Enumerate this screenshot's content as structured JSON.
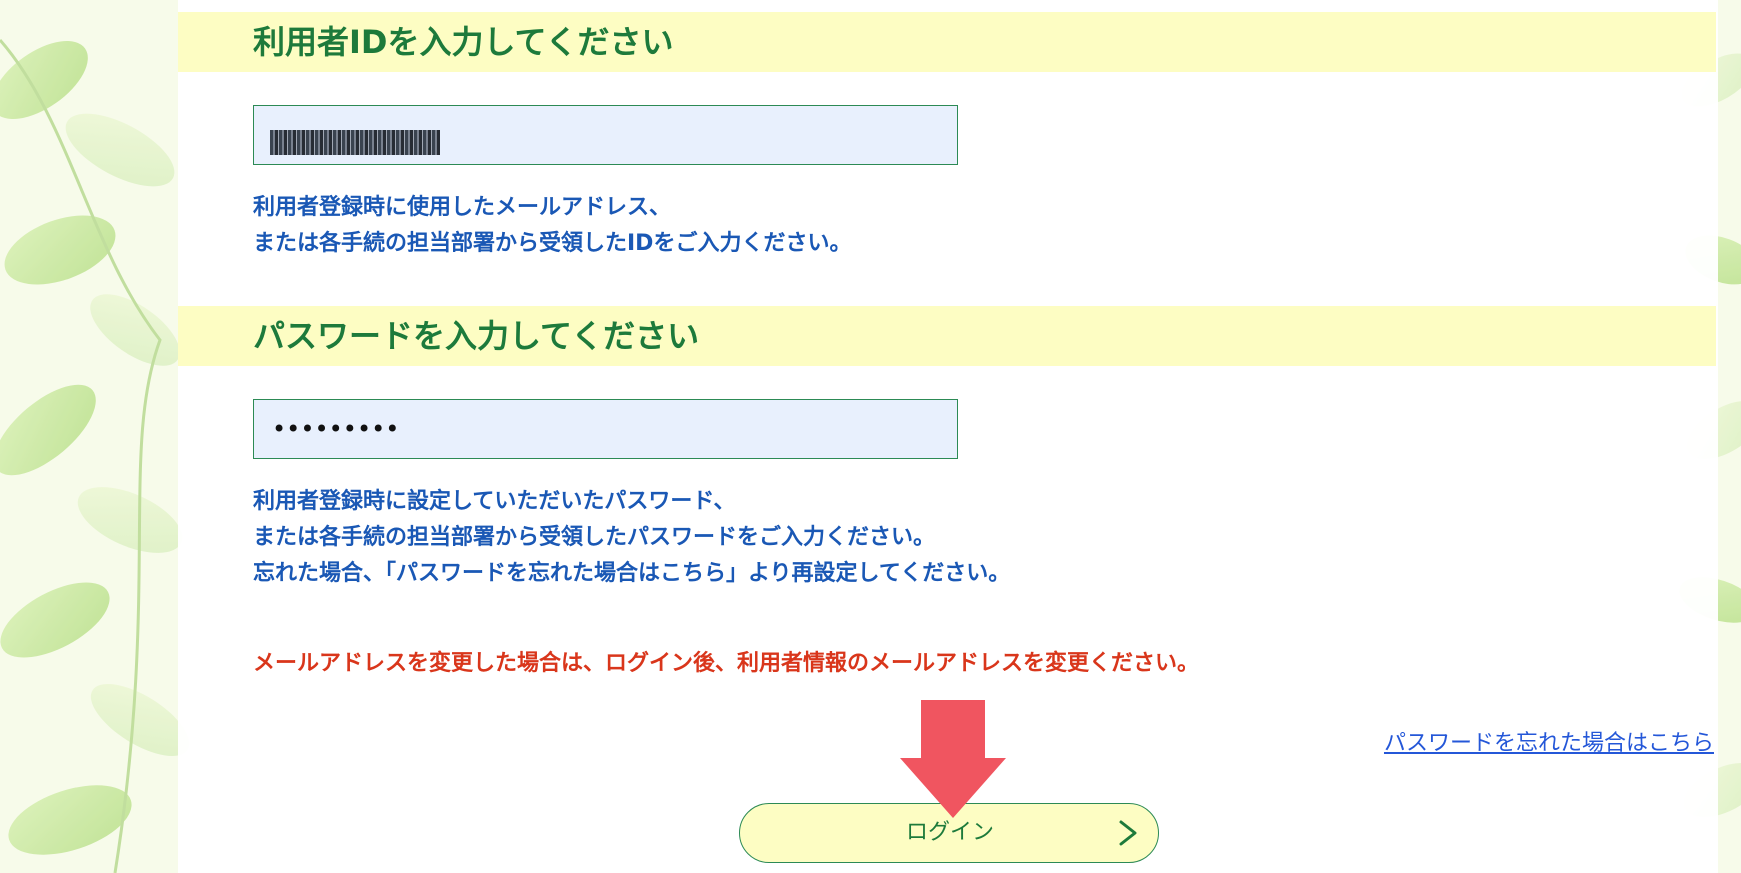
{
  "id_section": {
    "title": "利用者IDを入力してください",
    "field_value": "",
    "field_value_masked": true,
    "help_lines": [
      "利用者登録時に使用したメールアドレス、",
      "または各手続の担当部署から受領したIDをご入力ください。"
    ]
  },
  "password_section": {
    "title": "パスワードを入力してください",
    "field_value": "•••••••••",
    "help_lines": [
      "利用者登録時に設定していただいたパスワード、",
      "または各手続の担当部署から受領したパスワードをご入力ください。",
      "忘れた場合、「パスワードを忘れた場合はこちら」より再設定してください。"
    ]
  },
  "warning": {
    "text": "メールアドレスを変更した場合は、ログイン後、利用者情報のメールアドレスを変更ください。"
  },
  "links": {
    "forgot_password": "パスワードを忘れた場合はこちら"
  },
  "login_button": {
    "label": "ログイン",
    "icon": "chevron-right-icon"
  },
  "annotation": {
    "icon": "down-arrow-icon",
    "color": "#f05560"
  },
  "colors": {
    "heading_green": "#1d7a3b",
    "band_yellow": "#fdfdc3",
    "field_bg": "#e8f0fd",
    "help_blue": "#1a58b5",
    "warning_red": "#d9361b",
    "link_blue": "#2457d8"
  }
}
